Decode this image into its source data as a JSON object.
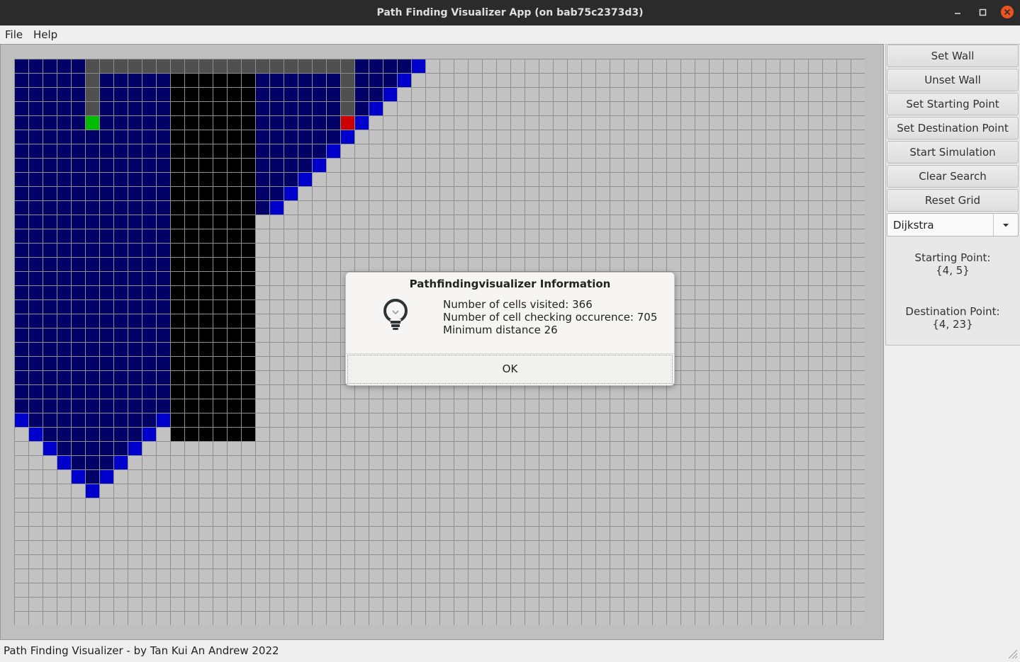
{
  "window": {
    "title": "Path Finding Visualizer App (on bab75c2373d3)",
    "controls": [
      "minimize-icon",
      "maximize-icon",
      "close-icon"
    ],
    "close_color": "#e95420"
  },
  "menu": {
    "file": "File",
    "help": "Help"
  },
  "grid": {
    "rows": 40,
    "cols": 60,
    "colors": {
      "empty": "#c2c2c2",
      "visited": "#000066",
      "frontier": "#0000cc",
      "wall": "#000000",
      "path": "#505050",
      "start": "#00bb00",
      "end": "#cc0000"
    }
  },
  "sidebar": {
    "buttons": [
      "Set Wall",
      "Unset Wall",
      "Set Starting Point",
      "Set Destination Point",
      "Start Simulation",
      "Clear Search",
      "Reset Grid"
    ],
    "algorithm": "Dijkstra",
    "starting_point_label": "Starting Point:",
    "starting_point_value": "{4, 5}",
    "destination_point_label": "Destination Point:",
    "destination_point_value": "{4, 23}"
  },
  "dialog": {
    "title": "Pathfindingvisualizer Information",
    "icon": "lightbulb-icon",
    "lines": [
      "Number of cells visited: 366",
      "Number of cell checking occurence: 705",
      "Minimum distance 26"
    ],
    "ok": "OK"
  },
  "status": {
    "text": "Path Finding Visualizer - by Tan Kui An Andrew 2022"
  }
}
